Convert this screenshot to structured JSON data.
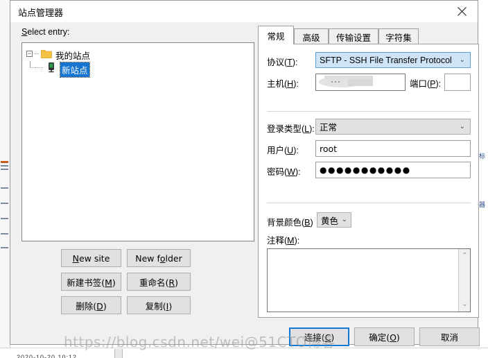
{
  "window": {
    "title": "站点管理器",
    "close_icon": "close-icon"
  },
  "left": {
    "select_label_pre": "S",
    "select_label_post": "elect entry:",
    "tree": {
      "root": {
        "label": "我的站点",
        "icon": "folder-icon",
        "expander": "−"
      },
      "child": {
        "label": "新站点",
        "icon": "server-icon",
        "selected": true
      }
    },
    "buttons": [
      {
        "name": "new-site-button",
        "pre": "N",
        "mid": "ew site",
        "post": ""
      },
      {
        "name": "new-folder-button",
        "pre": "New f",
        "mid": "o",
        "post": "lder"
      },
      {
        "name": "new-bookmark-button",
        "pre": "新建书签(",
        "mid": "M",
        "post": ")"
      },
      {
        "name": "rename-button",
        "pre": "重命名(",
        "mid": "R",
        "post": ")"
      },
      {
        "name": "delete-button",
        "pre": "删除(",
        "mid": "D",
        "post": ")"
      },
      {
        "name": "duplicate-button",
        "pre": "复制(",
        "mid": "I",
        "post": ")"
      }
    ]
  },
  "right": {
    "tabs": [
      {
        "label": "常规",
        "active": true
      },
      {
        "label": "高级",
        "active": false
      },
      {
        "label": "传输设置",
        "active": false
      },
      {
        "label": "字符集",
        "active": false
      }
    ],
    "fields": {
      "protocol": {
        "label_pre": "协议(",
        "label_key": "T",
        "label_post": "):",
        "value": "SFTP - SSH File Transfer Protocol",
        "chevron": "⌄"
      },
      "host": {
        "label_pre": "主机(",
        "label_key": "H",
        "label_post": "):",
        "value": ""
      },
      "port": {
        "label_pre": "端口(",
        "label_key": "P",
        "label_post": "):",
        "value": ""
      },
      "logon_type": {
        "label_pre": "登录类型(",
        "label_key": "L",
        "label_post": "):",
        "value": "正常",
        "chevron": "⌄"
      },
      "user": {
        "label_pre": "用户(",
        "label_key": "U",
        "label_post": "):",
        "value": "root"
      },
      "password": {
        "label_pre": "密码(",
        "label_key": "W",
        "label_post": "):",
        "value": "●●●●●●●●●●●"
      },
      "background_color": {
        "label_pre": "背景颜色(",
        "label_key": "B",
        "label_post": ")",
        "value": "黄色",
        "chevron": "⌄"
      },
      "comments": {
        "label_pre": "注释(",
        "label_key": "M",
        "label_post": "):",
        "value": "",
        "scroll_up": "⌃",
        "scroll_down": "⌄"
      }
    }
  },
  "footer": {
    "connect": {
      "pre": "连接(",
      "key": "C",
      "post": ")"
    },
    "ok": {
      "pre": "确定(",
      "key": "O",
      "post": ")"
    },
    "cancel": {
      "pre": "取消",
      "key": "",
      "post": ""
    }
  },
  "watermark": {
    "text": "https://blog.csdn.net/wei@51CTO博客"
  },
  "colors": {
    "selection_blue": "#1675d1",
    "focus_blue": "#0f7ad4",
    "combo_highlight": "#cfe5f7",
    "dialog_bg": "#f0f0f0",
    "button_bg": "#e1e1e1",
    "folder_yellow": "#f6c244"
  }
}
